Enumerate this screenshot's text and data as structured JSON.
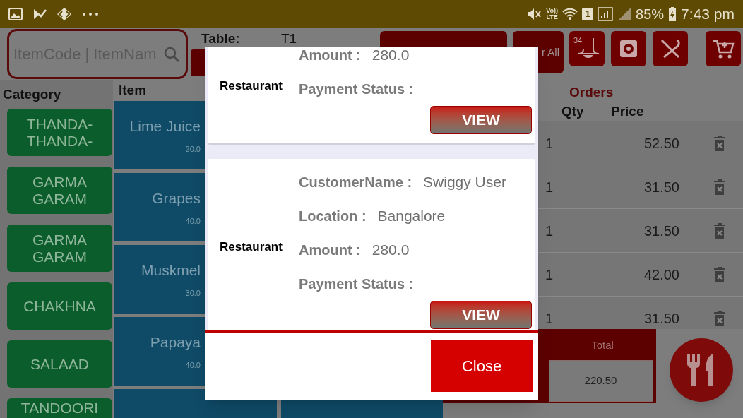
{
  "status_bar": {
    "volte_top": "Vo))",
    "volte_bottom": "LTE",
    "sim": "1",
    "battery": "85%",
    "time": "7:43 pm"
  },
  "search": {
    "placeholder": "ItemCode | ItemNam"
  },
  "table": {
    "label": "Table:",
    "value": "T1"
  },
  "clear_button": {
    "label": "r All"
  },
  "bell_badge": "34",
  "category_header": "Category",
  "categories": [
    {
      "label": "THANDA-\nTHANDA-"
    },
    {
      "label": "GARMA\nGARAM"
    },
    {
      "label": "GARMA\nGARAM"
    },
    {
      "label": "CHAKHNA"
    },
    {
      "label": "SALAAD"
    },
    {
      "label": "TANDOORI"
    }
  ],
  "item_header": "Item",
  "items": [
    {
      "name": "Lime Juice",
      "price": "20.0"
    },
    {
      "name": "Grapes",
      "price": "40.0"
    },
    {
      "name": "Muskmel",
      "price": "30.0"
    },
    {
      "name": "Papaya",
      "price": "40.0"
    }
  ],
  "orders": {
    "title": "Orders",
    "columns": [
      "Qty",
      "Price"
    ],
    "rows": [
      {
        "qty": "1",
        "price": "52.50"
      },
      {
        "qty": "1",
        "price": "31.50"
      },
      {
        "qty": "1",
        "price": "31.50"
      },
      {
        "qty": "1",
        "price": "42.00"
      },
      {
        "qty": "1",
        "price": "31.50"
      }
    ]
  },
  "total": {
    "label": "Total",
    "value": "220.50"
  },
  "dialog": {
    "cards": [
      {
        "restaurant": "Restaurant",
        "fields": [
          {
            "label": "Amount :",
            "value": "280.0"
          },
          {
            "label": "Payment Status :"
          }
        ],
        "button": "VIEW"
      },
      {
        "restaurant": "Restaurant",
        "fields": [
          {
            "label": "CustomerName :",
            "value": "Swiggy User"
          },
          {
            "label": "Location :",
            "value": "Bangalore"
          },
          {
            "label": "Amount :",
            "value": "280.0"
          },
          {
            "label": "Payment Status :"
          }
        ],
        "button": "VIEW"
      }
    ],
    "close": "Close"
  }
}
